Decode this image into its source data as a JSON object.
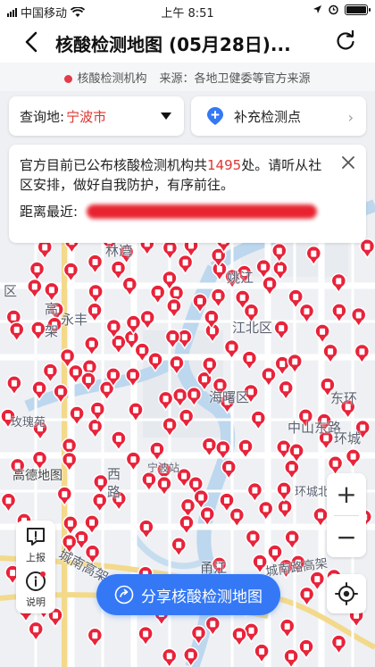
{
  "status_bar": {
    "carrier": "中国移动",
    "time": "上午 8:51"
  },
  "nav": {
    "title": "核酸检测地图 (05月28日)..."
  },
  "legend": {
    "label": "核酸检测机构",
    "source": "来源：各地卫健委等官方来源",
    "dot_color": "#e23b4a"
  },
  "query": {
    "label": "查询地:",
    "city": "宁波市"
  },
  "supplement": {
    "label": "补充检测点"
  },
  "info": {
    "text_before": "官方目前已公布核酸检测机构共",
    "count": "1495",
    "text_after": "处。请听从社区安排，做好自我防护，有序前往。",
    "nearest_label": "距离最近:"
  },
  "map_labels": [
    "林湾",
    "姚江",
    "江北区",
    "高",
    "架",
    "永丰",
    "海曙区",
    "中山东路",
    "环城",
    "宁波站",
    "高德地图",
    "城南高架",
    "玫瑰苑",
    "西",
    "路",
    "环城北路",
    "城南路高架",
    "甬江",
    "区",
    "东环"
  ],
  "side": {
    "report": "上报",
    "explain": "说明"
  },
  "share": {
    "label": "分享核酸检测地图"
  },
  "colors": {
    "accent": "#3478f6",
    "pin": "#e8233a",
    "highlight": "#e0352f"
  }
}
